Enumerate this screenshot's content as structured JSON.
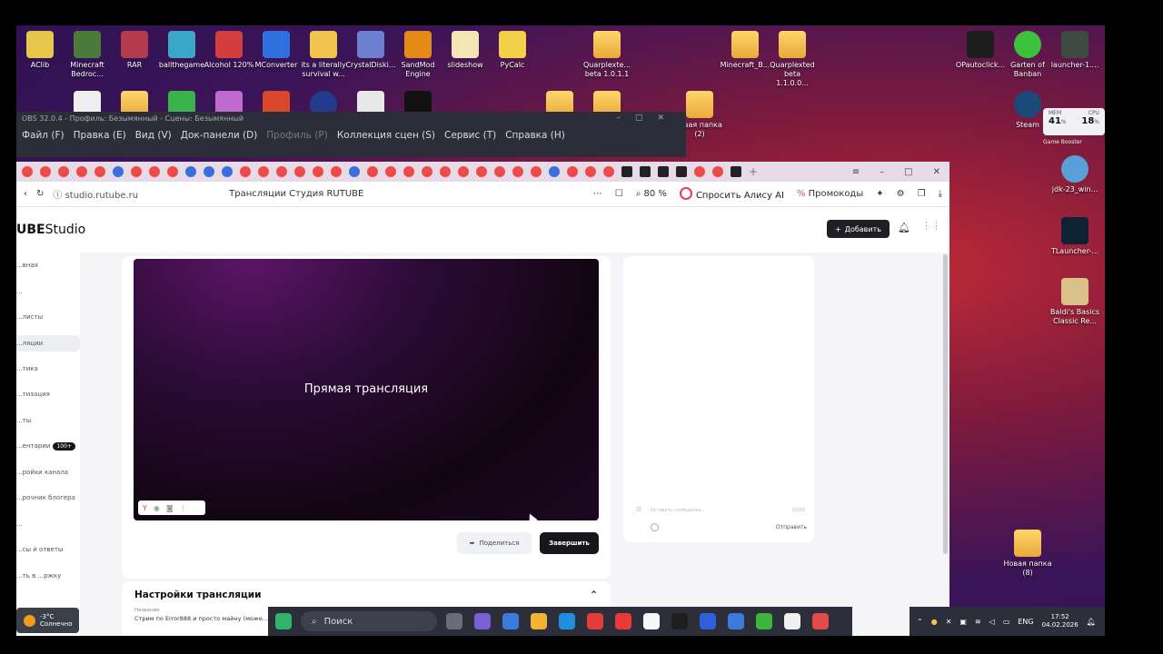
{
  "desktop": {
    "icons_row1": [
      {
        "label": "AClib",
        "color": "#e7c64a"
      },
      {
        "label": "Minecraft Bedroc...",
        "color": "#4b7a3a"
      },
      {
        "label": "RAR",
        "color": "#b23a4a"
      },
      {
        "label": "ballthegame",
        "color": "#3aa7c9"
      },
      {
        "label": "Alcohol 120%",
        "color": "#d43d3d"
      },
      {
        "label": "MConverter",
        "color": "#2f6fe0"
      },
      {
        "label": "its a literally survival w...",
        "color": "#f2c44d"
      },
      {
        "label": "CrystalDiski...",
        "color": "#6d7fd0"
      },
      {
        "label": "SandMod Engine",
        "color": "#e58a16"
      },
      {
        "label": "slideshow",
        "color": "#f3e6b5"
      },
      {
        "label": "PyCalc",
        "color": "#f2d048"
      }
    ],
    "folder_beta": "Quarplexte... beta 1.0.1.1",
    "folder_mc": "Minecraft_B...",
    "folder_beta2": "Quarplexted beta 1.1.0.0...",
    "right_icons": [
      {
        "label": "OPautoclick...",
        "color": "#222"
      },
      {
        "label": "Garten of Banban",
        "color": "#3bc13b"
      },
      {
        "label": "launcher-1....",
        "color": "#3d4a44"
      },
      {
        "label": "Steam",
        "color": "#1b4a7a"
      },
      {
        "label": "jdk-23_win...",
        "color": "#5aa0d8"
      },
      {
        "label": "TLauncher-...",
        "color": "#0e2233"
      },
      {
        "label": "Baldi's Basics Classic Re...",
        "color": "#d9c189"
      },
      {
        "label": "Новая папка (8)",
        "color": "#f2c44d"
      }
    ],
    "new_folder_2": "...вая папка (2)",
    "sys_monitor": {
      "mem_label": "MEM",
      "mem_value": "41",
      "cpu_label": "CPU",
      "cpu_value": "18",
      "unit": "%"
    },
    "game_booster": "Game Booster"
  },
  "obs": {
    "title": "OBS 32.0.4 - Профиль: Безымянный - Сцены: Безымянный",
    "menu": [
      "Файл (F)",
      "Правка (E)",
      "Вид (V)",
      "Док-панели (D)",
      "Профиль (P)",
      "Коллекция сцен (S)",
      "Сервис (T)",
      "Справка (H)"
    ]
  },
  "browser": {
    "url": "studio.rutube.ru",
    "page_title": "Трансляции   Студия RUTUBE",
    "zoom": "80 %",
    "alice": "Спросить Алису AI",
    "promo": "Промокоды"
  },
  "studio": {
    "logo_main": "UBE",
    "logo_sub": "Studio",
    "add_label": "Добавить",
    "sidebar": [
      {
        "label": "...вная"
      },
      {
        "label": "..."
      },
      {
        "label": "...листы"
      },
      {
        "label": "...ляции",
        "active": true
      },
      {
        "label": "...тика"
      },
      {
        "label": "...тизация"
      },
      {
        "label": "...ты"
      },
      {
        "label": "...ентарии",
        "badge": "100+"
      },
      {
        "label": "...ройки канала"
      },
      {
        "label": "...рочник блогера"
      },
      {
        "label": "..."
      },
      {
        "label": "...сы и ответы"
      },
      {
        "label": "...ть в ...ржку"
      }
    ],
    "video_title": "Прямая трансляция",
    "share_label": "Поделиться",
    "end_label": "Завершить",
    "chat_placeholder": "Оставить сообщение...",
    "chat_count": "0/200",
    "chat_send": "Отправить",
    "settings_title": "Настройки трансляции",
    "settings_name_label": "Название",
    "settings_name_value": "Стрим по Error888 и просто майну (може..."
  },
  "taskbar": {
    "weather_temp": "-3°C",
    "weather_desc": "Солнечно",
    "search_placeholder": "Поиск",
    "lang": "ENG",
    "time": "17:52",
    "date": "04.02.2026"
  }
}
